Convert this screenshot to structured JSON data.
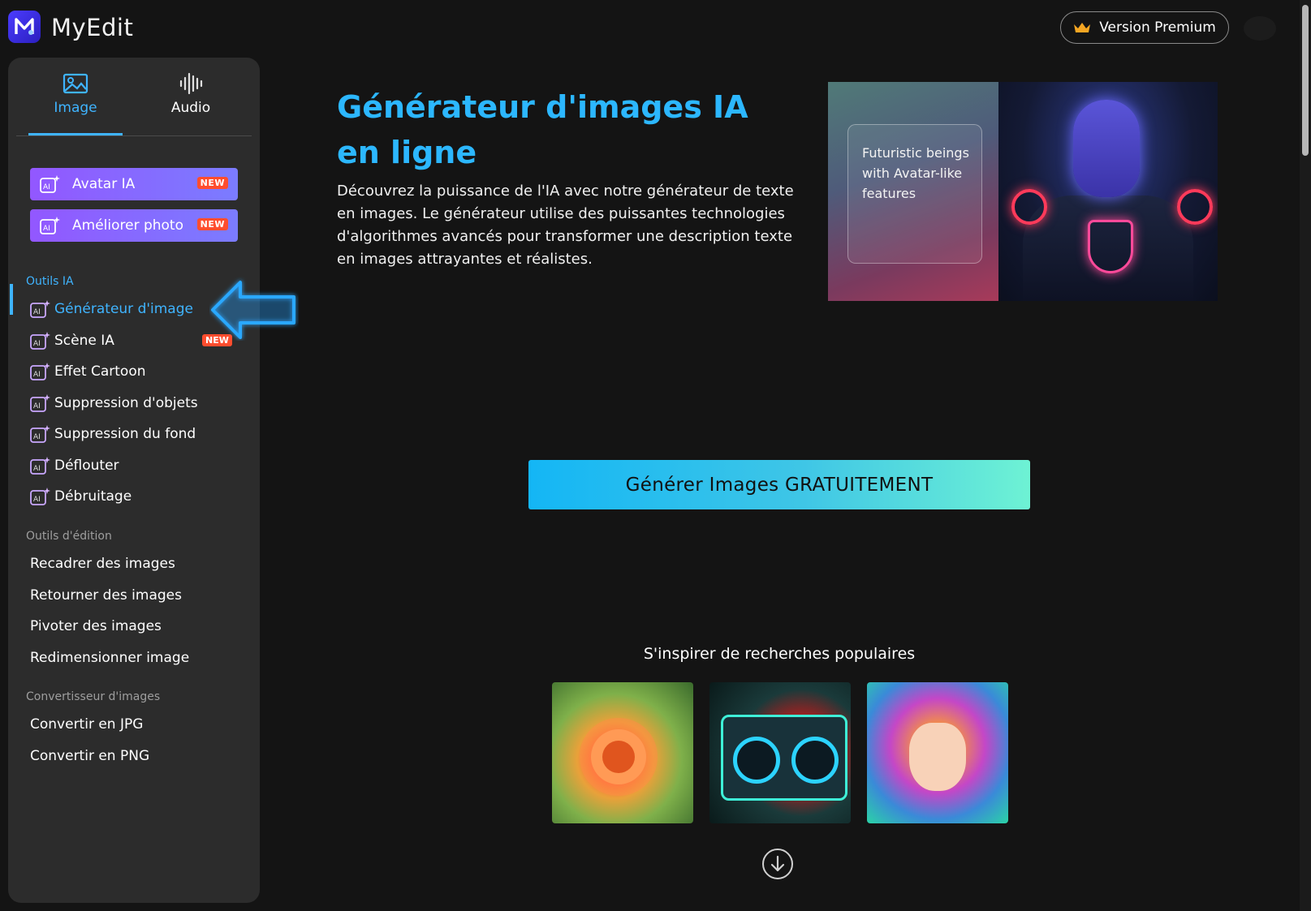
{
  "header": {
    "app_name": "MyEdit",
    "premium_label": "Version Premium"
  },
  "sidebar": {
    "tabs": [
      {
        "label": "Image",
        "icon": "image-icon"
      },
      {
        "label": "Audio",
        "icon": "waveform-icon"
      }
    ],
    "promos": [
      {
        "label": "Avatar IA",
        "badge": "NEW"
      },
      {
        "label": "Améliorer photo",
        "badge": "NEW"
      }
    ],
    "section_ai": "Outils IA",
    "ai_items": [
      {
        "label": "Générateur d'image",
        "active": true
      },
      {
        "label": "Scène IA",
        "badge": "NEW"
      },
      {
        "label": "Effet Cartoon"
      },
      {
        "label": "Suppression d'objets"
      },
      {
        "label": "Suppression du fond"
      },
      {
        "label": "Déflouter"
      },
      {
        "label": "Débruitage"
      }
    ],
    "section_edit": "Outils d'édition",
    "edit_items": [
      {
        "label": "Recadrer des images"
      },
      {
        "label": "Retourner des images"
      },
      {
        "label": "Pivoter des images"
      },
      {
        "label": "Redimensionner image"
      }
    ],
    "section_convert": "Convertisseur d'images",
    "convert_items": [
      {
        "label": "Convertir en JPG"
      },
      {
        "label": "Convertir en PNG"
      }
    ]
  },
  "main": {
    "title": "Générateur d'images IA en ligne",
    "description": "Découvrez la puissance de l'IA avec notre générateur de texte en images. Le générateur utilise des puissantes technologies d'algorithmes avancés pour transformer une description texte en images attrayantes et réalistes.",
    "hero_card_text": "Futuristic beings with Avatar-like features",
    "cta_label": "Générer Images GRATUITEMENT",
    "inspire_label": "S'inspirer de recherches populaires"
  },
  "colors": {
    "accent": "#2cb7ff",
    "badge": "#ff4d2e",
    "promo_start": "#9257ff",
    "promo_end": "#7b7cff"
  }
}
